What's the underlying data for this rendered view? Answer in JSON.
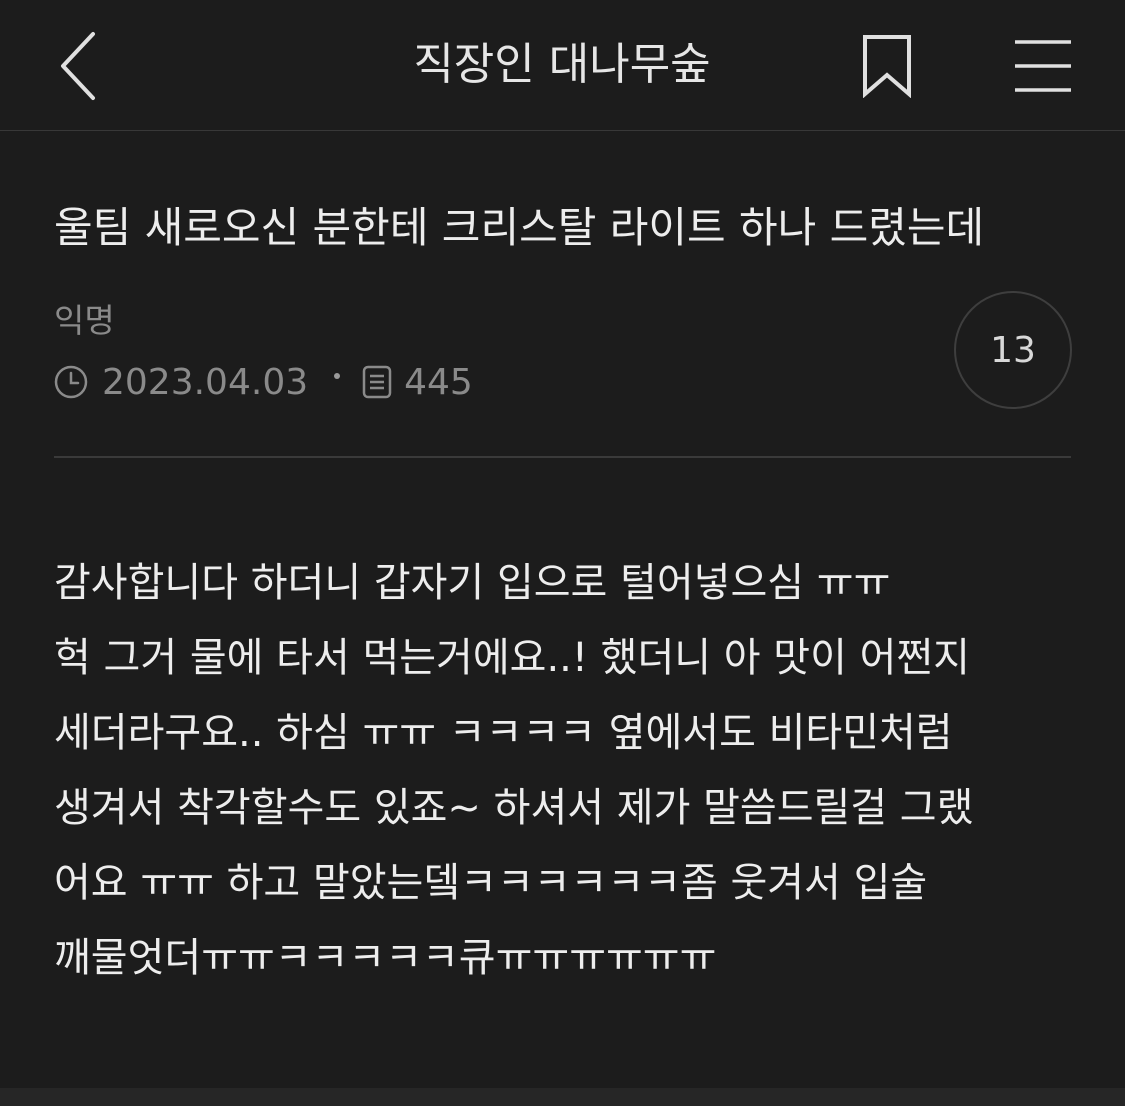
{
  "header": {
    "title": "직장인 대나무숲",
    "back_icon": "chevron-left-icon",
    "bookmark_icon": "bookmark-icon",
    "menu_icon": "hamburger-menu-icon"
  },
  "post": {
    "title": "울팀 새로오신 분한테 크리스탈 라이트 하나 드렸는데",
    "author": "익명",
    "date": "2023.04.03",
    "views": "445",
    "comment_count": "13",
    "body_lines": [
      "감사합니다 하더니 갑자기 입으로 털어넣으심 ㅠㅠ",
      "헉 그거 물에 타서 먹는거에요..! 했더니 아 맛이 어쩐지",
      "세더라구요.. 하심 ㅠㅠ ㅋㅋㅋㅋ 옆에서도 비타민처럼",
      "생겨서 착각할수도 있죠~ 하셔서 제가 말씀드릴걸 그랬",
      "어요 ㅠㅠ 하고 말았는뎈ㅋㅋㅋㅋㅋㅋ좀 웃겨서 입술",
      "깨물엇더ㅠㅠㅋㅋㅋㅋㅋ큐ㅠㅠㅠㅠㅠㅠ"
    ]
  },
  "colors": {
    "background": "#1c1c1c",
    "text": "#ededed",
    "muted": "#8a8a8a",
    "divider": "#3a3a3a"
  }
}
